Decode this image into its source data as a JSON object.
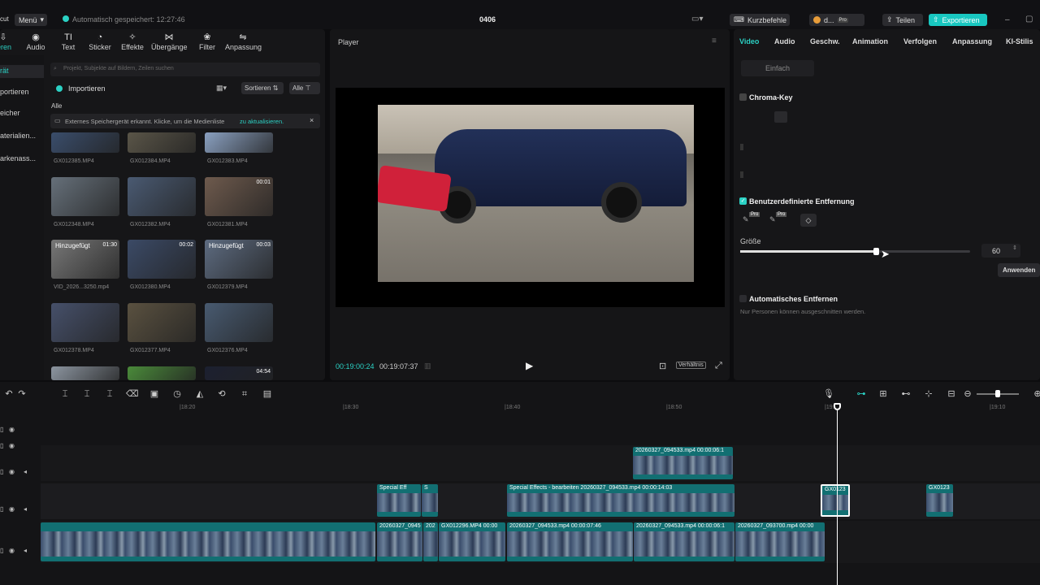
{
  "topbar": {
    "logo": "cut",
    "menu": "Menü",
    "autosave": "Automatisch gespeichert: 12:27:46",
    "project": "0406",
    "shortcuts": "Kurzbefehle",
    "user": "d...",
    "user_badge": "Pro",
    "share": "Teilen",
    "export": "Exportieren"
  },
  "toolbar": {
    "items": [
      {
        "label": "ieren",
        "icon": "import-icon"
      },
      {
        "label": "Audio",
        "icon": "audio-icon"
      },
      {
        "label": "Text",
        "icon": "text-icon"
      },
      {
        "label": "Sticker",
        "icon": "sticker-icon"
      },
      {
        "label": "Effekte",
        "icon": "effects-icon"
      },
      {
        "label": "Übergänge",
        "icon": "transitions-icon"
      },
      {
        "label": "Filter",
        "icon": "filter-icon"
      },
      {
        "label": "Anpassung",
        "icon": "adjust-icon"
      }
    ]
  },
  "sidebar": {
    "items": [
      "rät",
      "portieren",
      "eicher",
      "aterialien...",
      "arkenass..."
    ]
  },
  "media": {
    "search_placeholder": "Projekt, Subjekte auf Bildern, Zeilen suchen",
    "import": "Importieren",
    "sort": "Sortieren",
    "all_filter": "Alle",
    "all_label": "Alle",
    "notice": "Externes Speichergerät erkannt. Klicke, um die Medienliste",
    "notice_link": "zu aktualisieren.",
    "files": [
      {
        "name": "GX012385.MP4",
        "badge": "",
        "tag": ""
      },
      {
        "name": "GX012384.MP4",
        "badge": "",
        "tag": ""
      },
      {
        "name": "GX012383.MP4",
        "badge": "",
        "tag": ""
      },
      {
        "name": "GX012348.MP4",
        "badge": "",
        "tag": ""
      },
      {
        "name": "GX012382.MP4",
        "badge": "",
        "tag": ""
      },
      {
        "name": "GX012381.MP4",
        "badge": "00:01",
        "tag": ""
      },
      {
        "name": "VID_2026...3250.mp4",
        "badge": "01:30",
        "tag": "Hinzugefügt"
      },
      {
        "name": "GX012380.MP4",
        "badge": "00:02",
        "tag": ""
      },
      {
        "name": "GX012379.MP4",
        "badge": "00:03",
        "tag": "Hinzugefügt"
      },
      {
        "name": "GX012378.MP4",
        "badge": "",
        "tag": ""
      },
      {
        "name": "GX012377.MP4",
        "badge": "",
        "tag": ""
      },
      {
        "name": "GX012376.MP4",
        "badge": "",
        "tag": ""
      },
      {
        "name": "",
        "badge": "",
        "tag": ""
      },
      {
        "name": "",
        "badge": "",
        "tag": ""
      },
      {
        "name": "",
        "badge": "04:54",
        "tag": ""
      }
    ]
  },
  "player": {
    "title": "Player",
    "time_current": "00:19:00:24",
    "time_total": "00:19:07:37",
    "ratio": "Verhältnis"
  },
  "right": {
    "tabs": [
      "Video",
      "Audio",
      "Geschw.",
      "Animation",
      "Verfolgen",
      "Anpassung",
      "KI-Stilis"
    ],
    "subtab": "Einfach",
    "chroma": "Chroma-Key",
    "custom_remove": "Benutzerdefinierte Entfernung",
    "size_label": "Größe",
    "size_value": "60",
    "size_fraction": 0.59,
    "apply": "Anwenden",
    "auto_remove": "Automatisches Entfernen",
    "auto_desc": "Nur Personen können ausgeschnitten werden.",
    "pro1": "Pro",
    "pro2": "Pro"
  },
  "timeline": {
    "ruler": [
      "|18:20",
      "|18:30",
      "|18:40",
      "|18:50",
      "|19:00",
      "|19:10"
    ],
    "clips": [
      {
        "label": "20260327_094533.mp4  00:00:06:1"
      },
      {
        "label": "Special Eff"
      },
      {
        "label": "S"
      },
      {
        "label": "Special Effects - bearbeiten  20260327_094533.mp4  00:00:14:03"
      },
      {
        "label": "GX0123"
      },
      {
        "label": "GX0123"
      },
      {
        "label": ""
      },
      {
        "label": "20260327_0945"
      },
      {
        "label": "202"
      },
      {
        "label": "GX012296.MP4  00:00"
      },
      {
        "label": "20260327_094533.mp4  00:00:07:46"
      },
      {
        "label": "20260327_094533.mp4  00:00:06:1"
      },
      {
        "label": "20260327_093700.mp4  00:00"
      }
    ]
  }
}
